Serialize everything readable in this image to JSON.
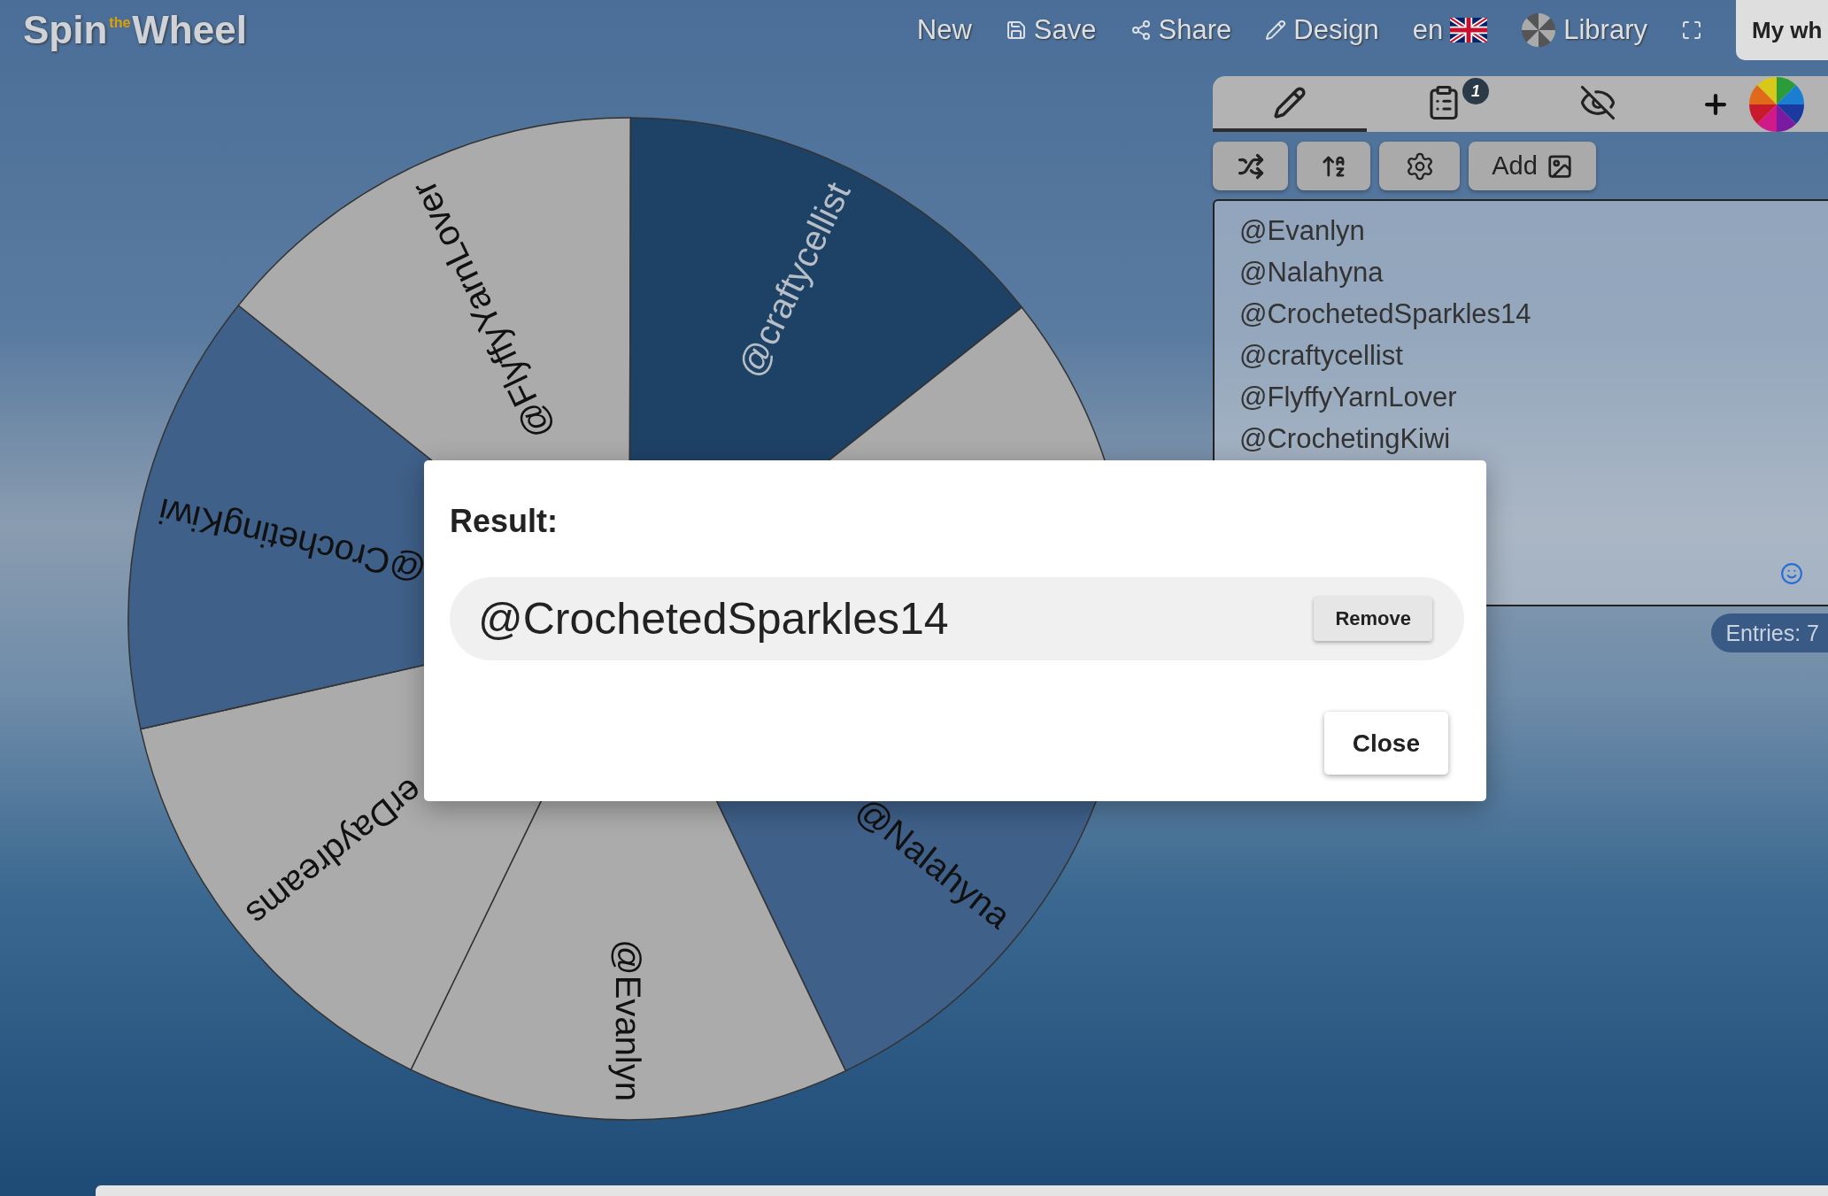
{
  "logo": {
    "first": "Spin",
    "small": "the",
    "last": "Wheel"
  },
  "nav": [
    {
      "kind": "plain",
      "label": "New"
    },
    {
      "kind": "save",
      "label": "Save"
    },
    {
      "kind": "share",
      "label": "Share"
    },
    {
      "kind": "design",
      "label": "Design"
    },
    {
      "kind": "language",
      "label": "en"
    },
    {
      "kind": "library",
      "label": "Library"
    },
    {
      "kind": "fullscreen"
    }
  ],
  "wheel_tab": {
    "label": "My wh"
  },
  "wheel": {
    "segments": [
      {
        "label": "@Nalahyna",
        "color": "#3f6089"
      },
      {
        "label": "@Evanlyn",
        "color": "#ababab"
      },
      {
        "label": "erDaydreams",
        "color": "#ababab"
      },
      {
        "label": "@CrochetingKiwi",
        "color": "#3f6089"
      },
      {
        "label": "@FlyffyYarnLover",
        "color": "#ababab"
      },
      {
        "label": "@craftycellist",
        "color": "#1e4266"
      },
      {
        "color": "#ababab"
      }
    ]
  },
  "panel": {
    "tabs": [
      {
        "kind": "edit",
        "selected": true
      },
      {
        "kind": "results",
        "selected": false,
        "badge": "1"
      },
      {
        "kind": "hide",
        "selected": false
      }
    ],
    "toolbar": [
      {
        "kind": "shuffle"
      },
      {
        "kind": "sort"
      },
      {
        "kind": "settings"
      },
      {
        "kind": "add_image",
        "label": "Add"
      }
    ],
    "entries": [
      "@Evanlyn",
      "@Nalahyna",
      "@CrochetedSparkles14",
      "@craftycellist",
      "@FlyffyYarnLover",
      "@CrochetingKiwi"
    ],
    "entries_count": "Entries: 7"
  },
  "dialog": {
    "title": "Result:",
    "result": "@CrochetedSparkles14",
    "remove": "Remove",
    "close": "Close"
  }
}
